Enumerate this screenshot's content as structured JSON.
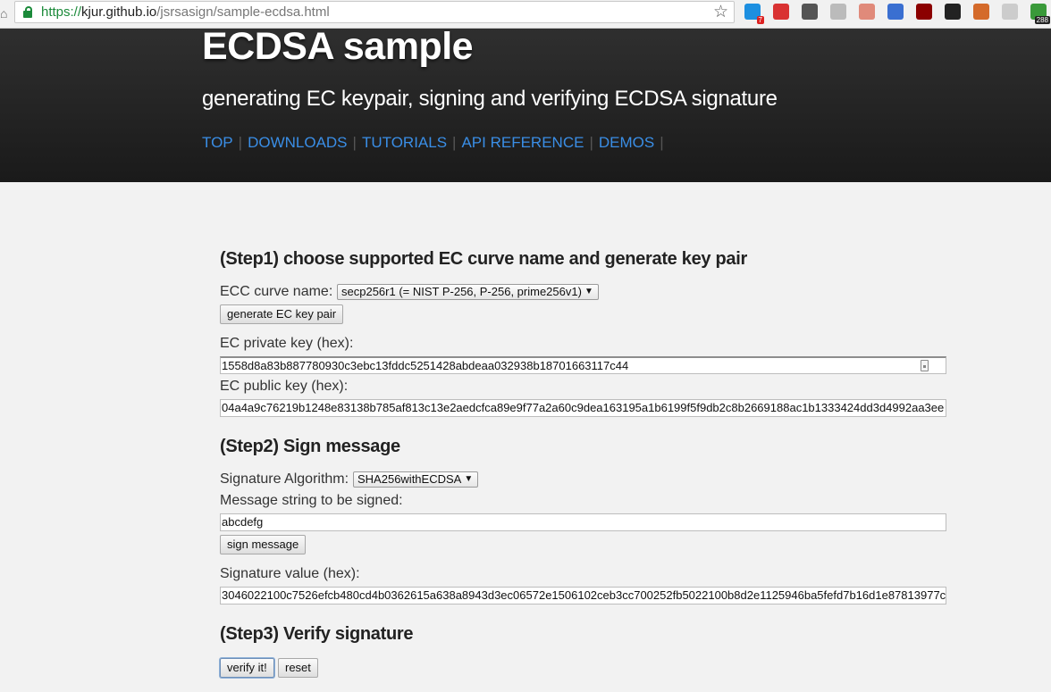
{
  "browser": {
    "url_scheme": "https://",
    "url_host": "kjur.github.io",
    "url_path": "/jsrsasign/sample-ecdsa.html",
    "extensions": [
      {
        "name": "twitter-ext-icon",
        "color": "#1d8fe0",
        "badge": "7",
        "badge_color": "#d22"
      },
      {
        "name": "dots-ext-icon",
        "color": "#d93232",
        "badge": "",
        "badge_color": ""
      },
      {
        "name": "pocket-ext-icon",
        "color": "#555555",
        "badge": "",
        "badge_color": ""
      },
      {
        "name": "extension-ext-icon",
        "color": "#bbbbbb",
        "badge": "",
        "badge_color": ""
      },
      {
        "name": "circle-ext-icon",
        "color": "#e08a7a",
        "badge": "",
        "badge_color": ""
      },
      {
        "name": "globe-ext-icon",
        "color": "#3a6fd1",
        "badge": "",
        "badge_color": ""
      },
      {
        "name": "ublock-ext-icon",
        "color": "#8b0000",
        "badge": "",
        "badge_color": ""
      },
      {
        "name": "languagetool-ext-icon",
        "color": "#222222",
        "badge": "",
        "badge_color": ""
      },
      {
        "name": "crab-ext-icon",
        "color": "#d46a2a",
        "badge": "",
        "badge_color": ""
      },
      {
        "name": "page-ext-icon",
        "color": "#cccccc",
        "badge": "",
        "badge_color": ""
      },
      {
        "name": "chart-ext-icon",
        "color": "#3a9a3a",
        "badge": "288",
        "badge_color": "#222"
      }
    ]
  },
  "header": {
    "title": "ECDSA sample",
    "subtitle": "generating EC keypair, signing and verifying ECDSA signature",
    "nav": [
      "TOP",
      "DOWNLOADS",
      "TUTORIALS",
      "API REFERENCE",
      "DEMOS"
    ],
    "link_color": "#3a8ee6"
  },
  "step1": {
    "heading": "(Step1) choose supported EC curve name and generate key pair",
    "curve_label": "ECC curve name:",
    "curve_selected": "secp256r1 (= NIST P-256, P-256, prime256v1)",
    "generate_button": "generate EC key pair",
    "private_key_label": "EC private key (hex):",
    "private_key_value": "1558d8a83b887780930c3ebc13fddc5251428abdeaa032938b18701663117c44",
    "public_key_label": "EC public key (hex):",
    "public_key_value": "04a4a9c76219b1248e83138b785af813c13e2aedcfca89e9f77a2a60c9dea163195a1b6199f5f9db2c8b2669188ac1b1333424dd3d4992aa3ee"
  },
  "step2": {
    "heading": "(Step2) Sign message",
    "algorithm_label": "Signature Algorithm:",
    "algorithm_selected": "SHA256withECDSA",
    "message_label": "Message string to be signed:",
    "message_value": "abcdefg",
    "sign_button": "sign message",
    "signature_label": "Signature value (hex):",
    "signature_value": "3046022100c7526efcb480cd4b0362615a638a8943d3ec06572e1506102ceb3cc700252fb5022100b8d2e1125946ba5fefd7b16d1e87813977c"
  },
  "step3": {
    "heading": "(Step3) Verify signature",
    "verify_button": "verify it!",
    "reset_button": "reset"
  }
}
